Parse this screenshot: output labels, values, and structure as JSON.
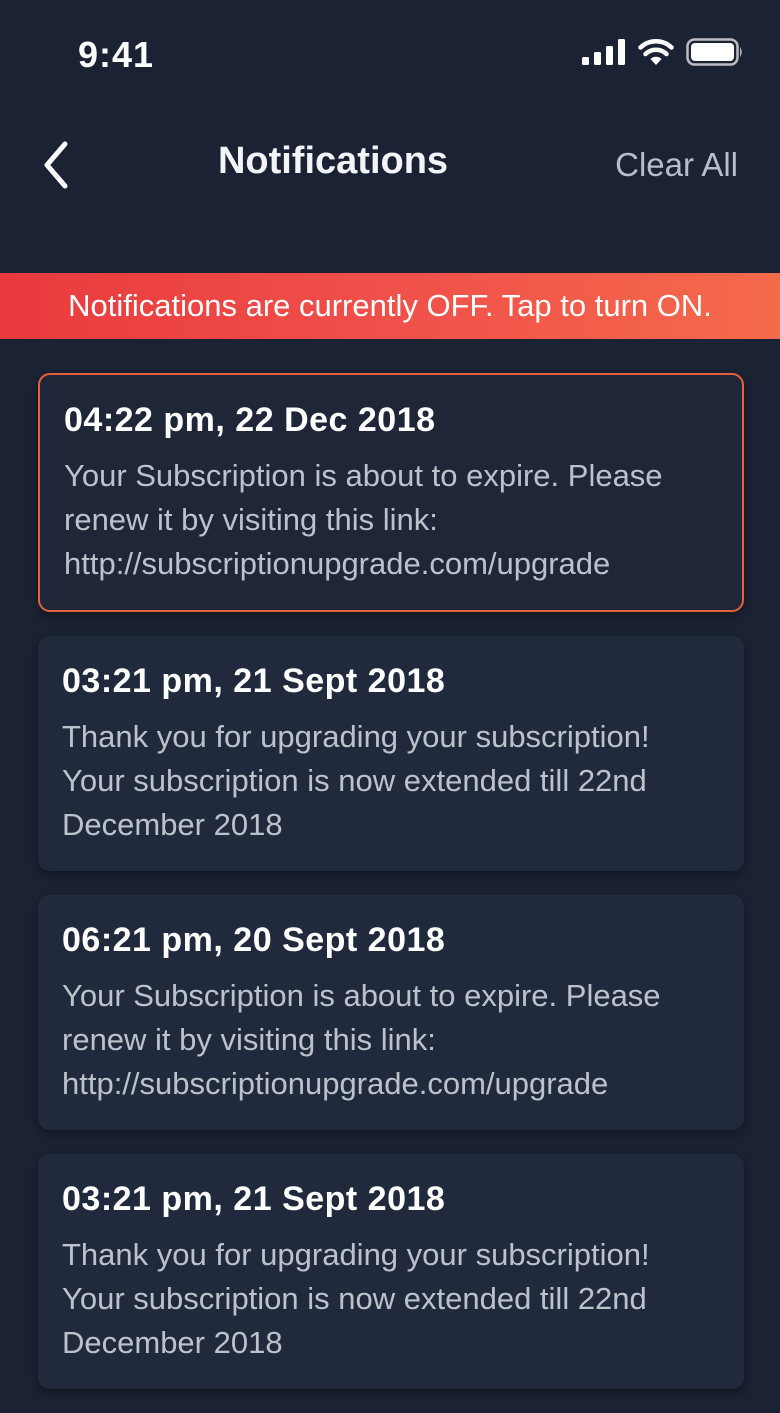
{
  "status_bar": {
    "time": "9:41",
    "icons": [
      "cellular-signal-icon",
      "wifi-icon",
      "battery-icon"
    ]
  },
  "header": {
    "title": "Notifications",
    "back_icon": "chevron-left-icon",
    "clear_all_label": "Clear All"
  },
  "banner": {
    "text": "Notifications are currently OFF. Tap to turn ON.",
    "colors": {
      "start": "#e93a3d",
      "end": "#f56a4b"
    }
  },
  "notifications": [
    {
      "time": "04:22 pm, 22 Dec 2018",
      "message_lines": [
        "Your Subscription is about to expire. Please",
        "renew it by visiting this link:",
        "http://subscriptionupgrade.com/upgrade"
      ],
      "highlighted": true
    },
    {
      "time": "03:21 pm, 21 Sept 2018",
      "message_lines": [
        "Thank you for upgrading your subscription!",
        "Your subscription is now extended till 22nd",
        "December 2018"
      ],
      "highlighted": false
    },
    {
      "time": "06:21 pm, 20 Sept 2018",
      "message_lines": [
        "Your Subscription is about to expire. Please",
        "renew it by visiting this link:",
        "http://subscriptionupgrade.com/upgrade"
      ],
      "highlighted": false
    },
    {
      "time": "03:21 pm, 21 Sept 2018",
      "message_lines": [
        "Thank you for upgrading your subscription!",
        "Your subscription is now extended till 22nd",
        "December 2018"
      ],
      "highlighted": false
    }
  ],
  "colors": {
    "background": "#1b2233",
    "card": "#212a3d",
    "highlight_border": "#e4613f",
    "secondary_text": "#bcc2cc"
  }
}
